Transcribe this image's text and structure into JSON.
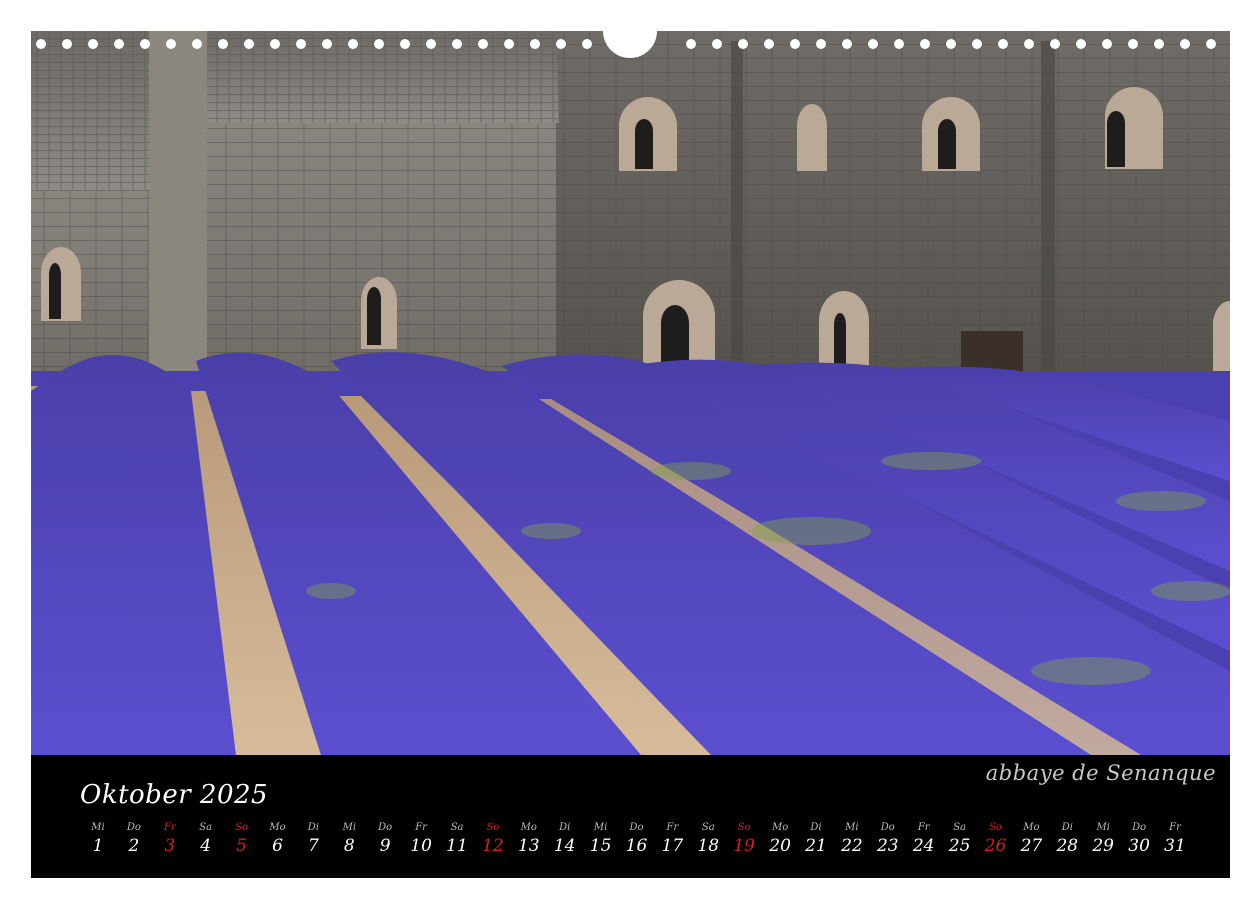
{
  "calendar": {
    "month_label": "Oktober 2025",
    "photo_caption": "abbaye de Senanque",
    "sunday_color": "#d62020",
    "days": [
      {
        "wd": "Mi",
        "num": "1",
        "sun": false
      },
      {
        "wd": "Do",
        "num": "2",
        "sun": false
      },
      {
        "wd": "Fr",
        "num": "3",
        "sun": true
      },
      {
        "wd": "Sa",
        "num": "4",
        "sun": false
      },
      {
        "wd": "So",
        "num": "5",
        "sun": true
      },
      {
        "wd": "Mo",
        "num": "6",
        "sun": false
      },
      {
        "wd": "Di",
        "num": "7",
        "sun": false
      },
      {
        "wd": "Mi",
        "num": "8",
        "sun": false
      },
      {
        "wd": "Do",
        "num": "9",
        "sun": false
      },
      {
        "wd": "Fr",
        "num": "10",
        "sun": false
      },
      {
        "wd": "Sa",
        "num": "11",
        "sun": false
      },
      {
        "wd": "So",
        "num": "12",
        "sun": true
      },
      {
        "wd": "Mo",
        "num": "13",
        "sun": false
      },
      {
        "wd": "Di",
        "num": "14",
        "sun": false
      },
      {
        "wd": "Mi",
        "num": "15",
        "sun": false
      },
      {
        "wd": "Do",
        "num": "16",
        "sun": false
      },
      {
        "wd": "Fr",
        "num": "17",
        "sun": false
      },
      {
        "wd": "Sa",
        "num": "18",
        "sun": false
      },
      {
        "wd": "So",
        "num": "19",
        "sun": true
      },
      {
        "wd": "Mo",
        "num": "20",
        "sun": false
      },
      {
        "wd": "Di",
        "num": "21",
        "sun": false
      },
      {
        "wd": "Mi",
        "num": "22",
        "sun": false
      },
      {
        "wd": "Do",
        "num": "23",
        "sun": false
      },
      {
        "wd": "Fr",
        "num": "24",
        "sun": false
      },
      {
        "wd": "Sa",
        "num": "25",
        "sun": false
      },
      {
        "wd": "So",
        "num": "26",
        "sun": true
      },
      {
        "wd": "Mo",
        "num": "27",
        "sun": false
      },
      {
        "wd": "Di",
        "num": "28",
        "sun": false
      },
      {
        "wd": "Mi",
        "num": "29",
        "sun": false
      },
      {
        "wd": "Do",
        "num": "30",
        "sun": false
      },
      {
        "wd": "Fr",
        "num": "31",
        "sun": false
      }
    ]
  },
  "photo": {
    "subject": "abbey-with-lavender-field",
    "lavender_color": "#5b4fc4",
    "stone_color": "#7a7670",
    "path_color": "#c9ae8f"
  }
}
